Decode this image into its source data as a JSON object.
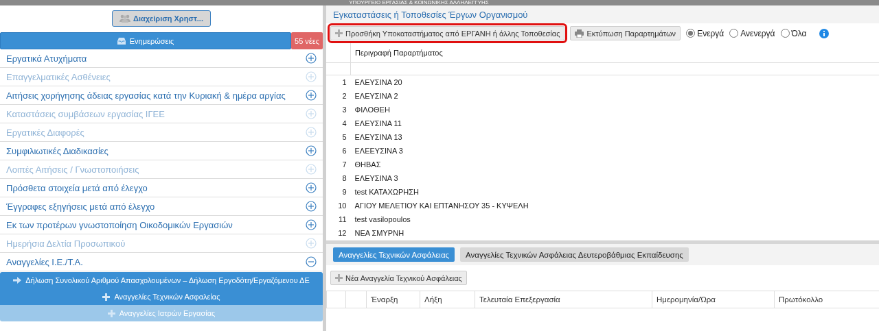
{
  "top_banner": {
    "text": "ΥΠΟΥΡΓΕΙΟ ΕΡΓΑΣΙΑΣ & ΚΟΙΝΩΝΙΚΗΣ ΑΛΛΗΛΕΓΓΥΗΣ"
  },
  "sidebar": {
    "user_button": "Διαχείριση Χρηστ...",
    "updates": {
      "label": "Ενημερώσεις",
      "badge": "55 νέες"
    },
    "items": [
      {
        "label": "Εργατικά Ατυχήματα",
        "disabled": false,
        "expanded": false
      },
      {
        "label": "Επαγγελματικές Ασθένειες",
        "disabled": true,
        "expanded": false
      },
      {
        "label": "Αιτήσεις χορήγησης άδειας εργασίας κατά την Κυριακή & ημέρα αργίας",
        "disabled": false,
        "expanded": false
      },
      {
        "label": "Καταστάσεις συμβάσεων εργασίας ΙΓΕΕ",
        "disabled": true,
        "expanded": false
      },
      {
        "label": "Εργατικές Διαφορές",
        "disabled": true,
        "expanded": false
      },
      {
        "label": "Συμφιλιωτικές Διαδικασίες",
        "disabled": false,
        "expanded": false
      },
      {
        "label": "Λοιπές Αιτήσεις / Γνωστοποιήσεις",
        "disabled": true,
        "expanded": false
      },
      {
        "label": "Πρόσθετα στοιχεία μετά από έλεγχο",
        "disabled": false,
        "expanded": false
      },
      {
        "label": "Έγγραφες εξηγήσεις μετά από έλεγχο",
        "disabled": false,
        "expanded": false
      },
      {
        "label": "Εκ των προτέρων γνωστοποίηση Οικοδομικών Εργασιών",
        "disabled": false,
        "expanded": false
      },
      {
        "label": "Ημερήσια Δελτία Προσωπικού",
        "disabled": true,
        "expanded": false
      },
      {
        "label": "Αναγγελίες Ι.Ε./Τ.Α.",
        "disabled": false,
        "expanded": true,
        "children": [
          {
            "label": "Δήλωση Συνολικού Αριθμού Απασχολουμένων – Δήλωση Εργοδότη/Εργαζόμενου ΔΕ",
            "kind": "arrow",
            "disabled": false
          },
          {
            "label": "Αναγγελίες Τεχνικών Ασφαλείας",
            "kind": "plus",
            "disabled": false
          },
          {
            "label": "Αναγγελίες Ιατρών Εργασίας",
            "kind": "plus",
            "disabled": true
          }
        ]
      }
    ]
  },
  "main": {
    "title": "Εγκαταστάσεις ή Τοποθεσίες Έργων Οργανισμού",
    "add_button": {
      "label": "Προσθήκη Υποκαταστήματος από ΕΡΓΑΝΗ ή άλλης Τοποθεσίας",
      "highlighted": true
    },
    "print_button": "Εκτύπωση Παραρτημάτων",
    "filters": [
      {
        "label": "Ενεργά",
        "selected": true
      },
      {
        "label": "Ανενεργά",
        "selected": false
      },
      {
        "label": "Όλα",
        "selected": false
      }
    ],
    "table": {
      "columns": [
        "",
        "Περιγραφή Παραρτήματος"
      ],
      "rows": [
        [
          "1",
          "ΕΛΕΥΣΙΝΑ 20"
        ],
        [
          "2",
          "ΕΛΕΥΣΙΝΑ 2"
        ],
        [
          "3",
          "ΦΙΛΟΘΕΗ"
        ],
        [
          "4",
          "ΕΛΕΥΣΙΝΑ 11"
        ],
        [
          "5",
          "ΕΛΕΥΣΙΝΑ 13"
        ],
        [
          "6",
          "ΕΛΕΕΥΣΙΝΑ 3"
        ],
        [
          "7",
          "ΘΗΒΑΣ"
        ],
        [
          "8",
          "ΕΛΕΥΣΙΝΑ 3"
        ],
        [
          "9",
          "test ΚΑΤΑΧΩΡΗΣΗ"
        ],
        [
          "10",
          "ΑΓΙΟΥ ΜΕΛΕΤΙΟΥ ΚΑΙ ΕΠΤΑΝΗΣΟΥ 35 - ΚΥΨΕΛΗ"
        ],
        [
          "11",
          "test vasilopoulos"
        ],
        [
          "12",
          "ΝΕΑ ΣΜΥΡΝΗ"
        ]
      ]
    }
  },
  "lower": {
    "tabs": [
      {
        "label": "Αναγγελίες Τεχνικών Ασφάλειας",
        "selected": true
      },
      {
        "label": "Αναγγελίες Τεχνικών Ασφάλειας Δευτεροβάθμιας Εκπαίδευσης",
        "selected": false
      }
    ],
    "new_button": "Νέα Αναγγελία Τεχνικού Ασφάλειας",
    "table": {
      "columns": [
        "Έναρξη",
        "Λήξη",
        "Τελευταία Επεξεργασία",
        "Ημερομηνία/Ώρα",
        "Πρωτόκολλο"
      ]
    }
  }
}
